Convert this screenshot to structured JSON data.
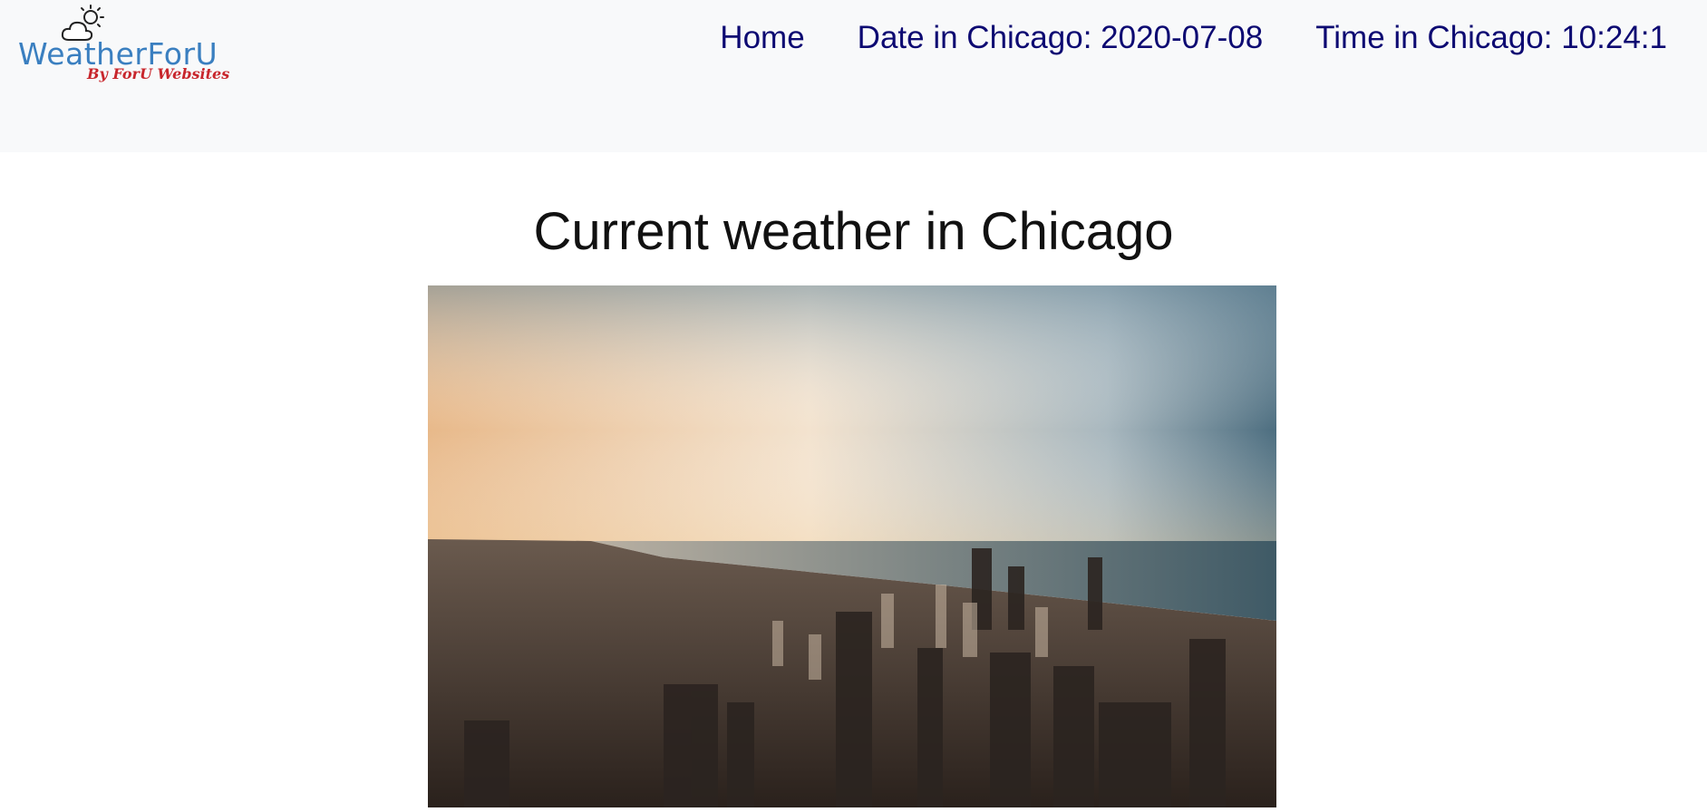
{
  "brand": {
    "name": "WeatherForU",
    "tagline": "By ForU Websites"
  },
  "nav": {
    "home": "Home",
    "date": "Date in Chicago: 2020-07-08",
    "time": "Time in Chicago: 10:24:1"
  },
  "main": {
    "title": "Current weather in Chicago"
  },
  "icons": {
    "logo": "sun-cloud-icon"
  },
  "colors": {
    "nav_text": "#0d0a72",
    "navbar_bg": "#f8f9fa",
    "logo_blue": "#3a7fc0",
    "logo_red": "#c8262c"
  }
}
